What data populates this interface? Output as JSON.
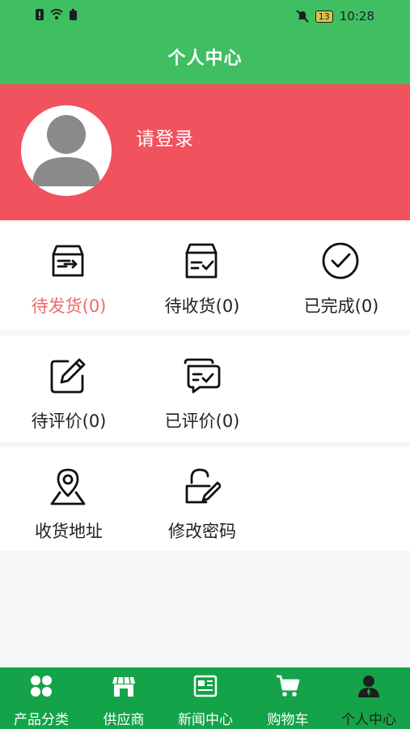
{
  "status_bar": {
    "time": "10:28",
    "battery": "13"
  },
  "header": {
    "title": "个人中心"
  },
  "profile": {
    "login_prompt": "请登录"
  },
  "orders": [
    {
      "label": "待发货(0)",
      "icon": "outbox-icon"
    },
    {
      "label": "待收货(0)",
      "icon": "inbox-check-icon"
    },
    {
      "label": "已完成(0)",
      "icon": "check-circle-icon"
    }
  ],
  "reviews": [
    {
      "label": "待评价(0)",
      "icon": "edit-icon"
    },
    {
      "label": "已评价(0)",
      "icon": "chat-check-icon"
    }
  ],
  "settings": [
    {
      "label": "收货地址",
      "icon": "location-icon"
    },
    {
      "label": "修改密码",
      "icon": "lock-edit-icon"
    }
  ],
  "tabs": [
    {
      "label": "产品分类",
      "icon": "grid-icon"
    },
    {
      "label": "供应商",
      "icon": "store-icon"
    },
    {
      "label": "新闻中心",
      "icon": "news-icon"
    },
    {
      "label": "购物车",
      "icon": "cart-icon"
    },
    {
      "label": "个人中心",
      "icon": "user-icon"
    }
  ],
  "colors": {
    "header": "#3fbf62",
    "hero": "#f0525e",
    "tabbar": "#14a348",
    "highlight": "#ec6a6a"
  }
}
